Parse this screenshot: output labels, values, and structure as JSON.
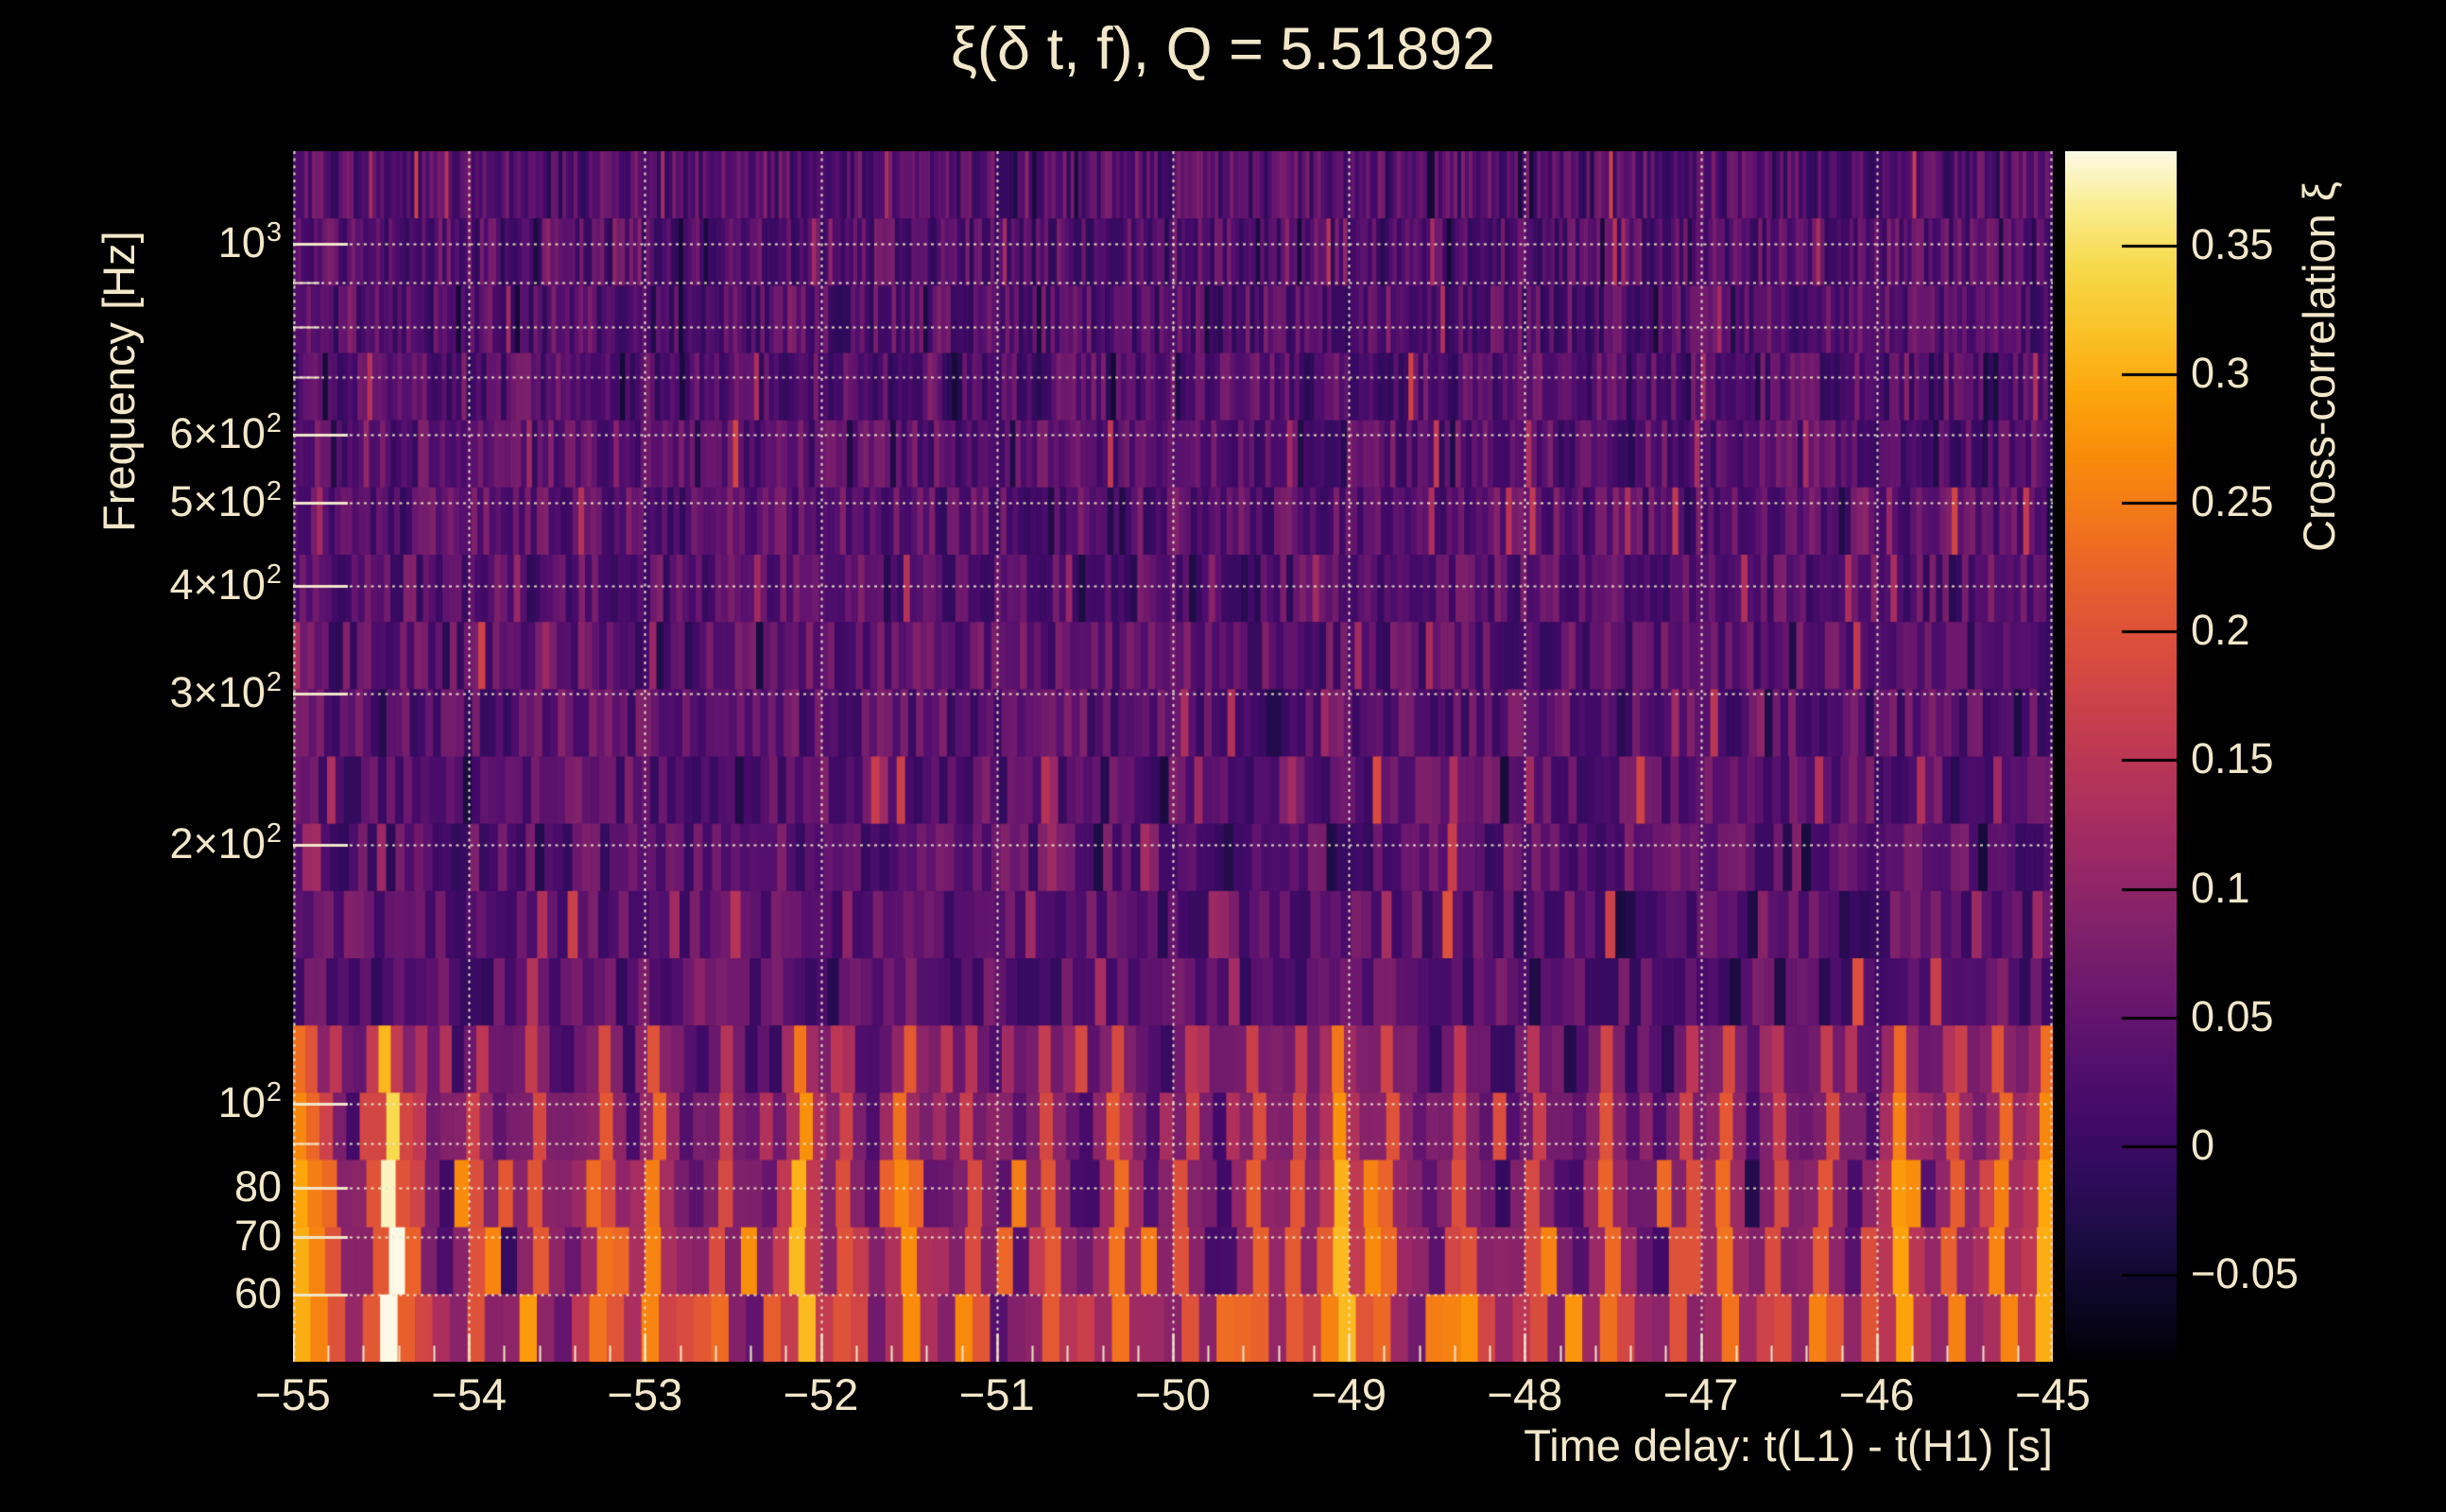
{
  "title": "ξ(δ t, f), Q = 5.51892",
  "colors": {
    "background": "#000000",
    "text": "#f2e7c9",
    "grid": "#f0e5c8",
    "colorbar_tick": "#000000"
  },
  "chart_data": {
    "type": "heatmap",
    "title": "ξ(δ t, f), Q = 5.51892",
    "q_value": 5.51892,
    "xlabel": "Time delay: t(L1) - t(H1) [s]",
    "ylabel": "Frequency [Hz]",
    "colorbar_label": "Cross-correlation ξ",
    "x_range": [
      -55,
      -45
    ],
    "y_range_hz": [
      50.2,
      1280
    ],
    "y_scale": "log",
    "grid": true,
    "x_ticks": [
      {
        "t": -55,
        "label": "−55"
      },
      {
        "t": -54,
        "label": "−54"
      },
      {
        "t": -53,
        "label": "−53"
      },
      {
        "t": -52,
        "label": "−52"
      },
      {
        "t": -51,
        "label": "−51"
      },
      {
        "t": -50,
        "label": "−50"
      },
      {
        "t": -49,
        "label": "−49"
      },
      {
        "t": -48,
        "label": "−48"
      },
      {
        "t": -47,
        "label": "−47"
      },
      {
        "t": -46,
        "label": "−46"
      },
      {
        "t": -45,
        "label": "−45"
      }
    ],
    "x_minor_tick_step": 0.2,
    "y_ticks": [
      {
        "f": 1000,
        "mantissa": "10",
        "exp": "3"
      },
      {
        "f": 600,
        "mantissa": "6×10",
        "exp": "2"
      },
      {
        "f": 500,
        "mantissa": "5×10",
        "exp": "2"
      },
      {
        "f": 400,
        "mantissa": "4×10",
        "exp": "2"
      },
      {
        "f": 300,
        "mantissa": "3×10",
        "exp": "2"
      },
      {
        "f": 200,
        "mantissa": "2×10",
        "exp": "2"
      },
      {
        "f": 100,
        "mantissa": "10",
        "exp": "2"
      },
      {
        "f": 80,
        "mantissa": "80",
        "exp": ""
      },
      {
        "f": 70,
        "mantissa": "70",
        "exp": ""
      },
      {
        "f": 60,
        "mantissa": "60",
        "exp": ""
      }
    ],
    "y_minor_ticks": [
      900,
      800,
      700,
      90
    ],
    "y_gridlines": [
      1000,
      900,
      800,
      700,
      600,
      500,
      400,
      300,
      200,
      100,
      90,
      80,
      70,
      60
    ],
    "colorbar_range": [
      -0.0838,
      0.3867
    ],
    "colorbar_ticks": [
      {
        "v": 0.35,
        "label": "0.35"
      },
      {
        "v": 0.3,
        "label": "0.3"
      },
      {
        "v": 0.25,
        "label": "0.25"
      },
      {
        "v": 0.2,
        "label": "0.2"
      },
      {
        "v": 0.15,
        "label": "0.15"
      },
      {
        "v": 0.1,
        "label": "0.1"
      },
      {
        "v": 0.05,
        "label": "0.05"
      },
      {
        "v": 0,
        "label": "0"
      },
      {
        "v": -0.05,
        "label": "−0.05"
      }
    ],
    "colormap": "inferno",
    "colormap_stops": [
      [
        0.0,
        0,
        0,
        4
      ],
      [
        0.05,
        11,
        7,
        37
      ],
      [
        0.1,
        26,
        12,
        65
      ],
      [
        0.15,
        46,
        11,
        90
      ],
      [
        0.2,
        66,
        10,
        104
      ],
      [
        0.25,
        85,
        16,
        109
      ],
      [
        0.3,
        106,
        23,
        110
      ],
      [
        0.35,
        125,
        32,
        107
      ],
      [
        0.4,
        147,
        38,
        103
      ],
      [
        0.45,
        168,
        46,
        95
      ],
      [
        0.5,
        188,
        55,
        84
      ],
      [
        0.55,
        206,
        67,
        71
      ],
      [
        0.6,
        221,
        81,
        58
      ],
      [
        0.65,
        233,
        97,
        43
      ],
      [
        0.7,
        243,
        120,
        25
      ],
      [
        0.75,
        249,
        140,
        10
      ],
      [
        0.8,
        252,
        166,
        12
      ],
      [
        0.85,
        250,
        193,
        39
      ],
      [
        0.9,
        246,
        215,
        70
      ],
      [
        0.95,
        250,
        235,
        135
      ],
      [
        1.0,
        252,
        250,
        230
      ]
    ],
    "background_xi_typical": [
      -0.02,
      0.07
    ],
    "notable_streaks": [
      {
        "t": -54.99,
        "xi": 0.3
      },
      {
        "t": -54.88,
        "xi": 0.26
      },
      {
        "t": -54.78,
        "xi": 0.2
      },
      {
        "t": -54.45,
        "xi": 0.387
      },
      {
        "t": -54.28,
        "xi": 0.18
      },
      {
        "t": -53.95,
        "xi": 0.2
      },
      {
        "t": -53.62,
        "xi": 0.21
      },
      {
        "t": -53.25,
        "xi": 0.24
      },
      {
        "t": -52.95,
        "xi": 0.26
      },
      {
        "t": -52.55,
        "xi": 0.19
      },
      {
        "t": -52.12,
        "xi": 0.31
      },
      {
        "t": -51.88,
        "xi": 0.2
      },
      {
        "t": -51.52,
        "xi": 0.27
      },
      {
        "t": -51.15,
        "xi": 0.19
      },
      {
        "t": -50.72,
        "xi": 0.21
      },
      {
        "t": -50.32,
        "xi": 0.24
      },
      {
        "t": -49.92,
        "xi": 0.2
      },
      {
        "t": -49.52,
        "xi": 0.22
      },
      {
        "t": -49.28,
        "xi": 0.21
      },
      {
        "t": -49.05,
        "xi": 0.31
      },
      {
        "t": -48.78,
        "xi": 0.23
      },
      {
        "t": -48.35,
        "xi": 0.2
      },
      {
        "t": -47.92,
        "xi": 0.19
      },
      {
        "t": -47.52,
        "xi": 0.23
      },
      {
        "t": -47.08,
        "xi": 0.2
      },
      {
        "t": -46.85,
        "xi": 0.24
      },
      {
        "t": -46.55,
        "xi": 0.19
      },
      {
        "t": -46.28,
        "xi": 0.21
      },
      {
        "t": -45.85,
        "xi": 0.29
      },
      {
        "t": -45.55,
        "xi": 0.22
      },
      {
        "t": -45.28,
        "xi": 0.26
      },
      {
        "t": -45.03,
        "xi": 0.3
      }
    ]
  }
}
